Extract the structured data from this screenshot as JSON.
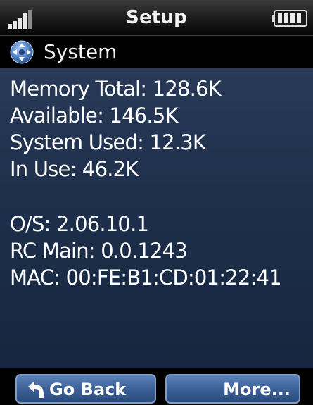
{
  "status_bar": {
    "title": "Setup",
    "signal_icon": "signal-strength-icon",
    "battery_icon": "battery-icon"
  },
  "header": {
    "icon": "navigation-cluster-icon",
    "title": "System"
  },
  "info": {
    "memory_total": "Memory Total: 128.6K",
    "available": "Available: 146.5K",
    "system_used": "System Used: 12.3K",
    "in_use": "In Use: 46.2K",
    "os": "O/S: 2.06.10.1",
    "rc_main": "RC Main: 0.0.1243",
    "mac": "MAC: 00:FE:B1:CD:01:22:41"
  },
  "softkeys": {
    "left_label": "Go Back",
    "left_icon": "back-arrow-icon",
    "right_label": "More..."
  },
  "colors": {
    "content_background": "#1f3150",
    "softkey": "#3d6199",
    "header_background": "#000000"
  }
}
